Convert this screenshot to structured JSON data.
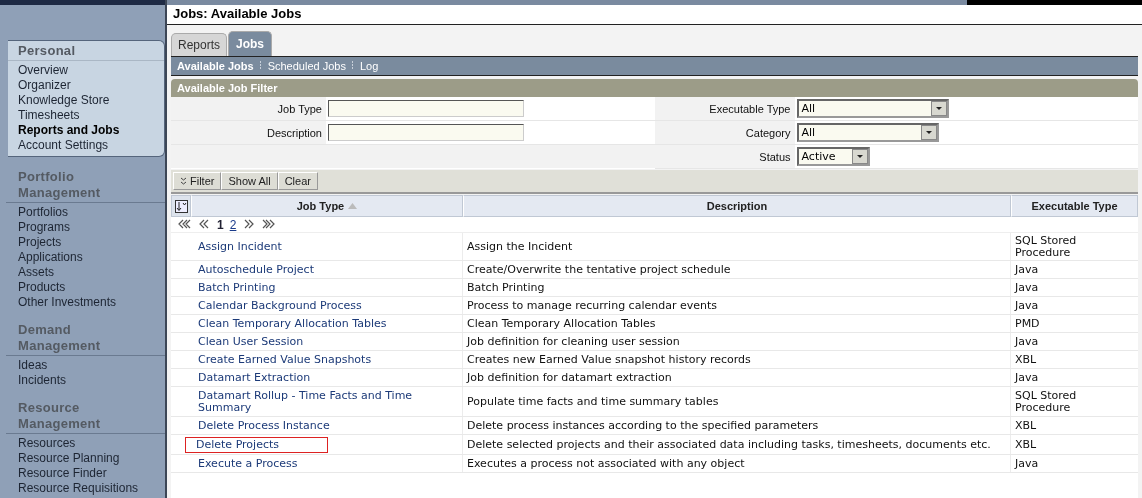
{
  "sidebar": {
    "sections": [
      {
        "title": "Personal",
        "selected": true,
        "items": [
          {
            "label": "Overview",
            "selected": false
          },
          {
            "label": "Organizer",
            "selected": false
          },
          {
            "label": "Knowledge Store",
            "selected": false
          },
          {
            "label": "Timesheets",
            "selected": false
          },
          {
            "label": "Reports and Jobs",
            "selected": true
          },
          {
            "label": "Account Settings",
            "selected": false
          }
        ]
      },
      {
        "title": "Portfolio Management",
        "selected": false,
        "items": [
          {
            "label": "Portfolios",
            "selected": false
          },
          {
            "label": "Programs",
            "selected": false
          },
          {
            "label": "Projects",
            "selected": false
          },
          {
            "label": "Applications",
            "selected": false
          },
          {
            "label": "Assets",
            "selected": false
          },
          {
            "label": "Products",
            "selected": false
          },
          {
            "label": "Other Investments",
            "selected": false
          }
        ]
      },
      {
        "title": "Demand Management",
        "selected": false,
        "items": [
          {
            "label": "Ideas",
            "selected": false
          },
          {
            "label": "Incidents",
            "selected": false
          }
        ]
      },
      {
        "title": "Resource Management",
        "selected": false,
        "items": [
          {
            "label": "Resources",
            "selected": false
          },
          {
            "label": "Resource Planning",
            "selected": false
          },
          {
            "label": "Resource Finder",
            "selected": false
          },
          {
            "label": "Resource Requisitions",
            "selected": false
          }
        ]
      }
    ]
  },
  "page_title": "Jobs: Available Jobs",
  "tabs": [
    {
      "label": "Reports",
      "selected": false
    },
    {
      "label": "Jobs",
      "selected": true
    }
  ],
  "subnav": [
    {
      "label": "Available Jobs",
      "selected": true
    },
    {
      "label": "Scheduled Jobs",
      "selected": false
    },
    {
      "label": "Log",
      "selected": false
    }
  ],
  "filter": {
    "title": "Available Job Filter",
    "left": [
      {
        "label": "Job Type",
        "kind": "text"
      },
      {
        "label": "Description",
        "kind": "text"
      }
    ],
    "right": [
      {
        "label": "Executable Type",
        "kind": "select",
        "value": "All"
      },
      {
        "label": "Category",
        "kind": "select",
        "value": "All"
      },
      {
        "label": "Status",
        "kind": "select",
        "value": "Active"
      }
    ]
  },
  "buttons": [
    {
      "label": "Filter",
      "kind": "toggle"
    },
    {
      "label": "Show All",
      "kind": "plain"
    },
    {
      "label": "Clear",
      "kind": "plain"
    }
  ],
  "table": {
    "columns": [
      {
        "label": "Job Type",
        "sorted": true
      },
      {
        "label": "Description",
        "sorted": false
      },
      {
        "label": "Executable Type",
        "sorted": false
      }
    ],
    "pages": [
      {
        "label": "1",
        "selected": true
      },
      {
        "label": "2",
        "selected": false
      }
    ],
    "rows": [
      {
        "job_type": "Assign Incident",
        "description": "Assign the Incident",
        "executable_type": "SQL Stored Procedure",
        "highlighted": false
      },
      {
        "job_type": "Autoschedule Project",
        "description": "Create/Overwrite the tentative project schedule",
        "executable_type": "Java",
        "highlighted": false
      },
      {
        "job_type": "Batch Printing",
        "description": "Batch Printing",
        "executable_type": "Java",
        "highlighted": false
      },
      {
        "job_type": "Calendar Background Process",
        "description": "Process to manage recurring calendar events",
        "executable_type": "Java",
        "highlighted": false
      },
      {
        "job_type": "Clean Temporary Allocation Tables",
        "description": "Clean Temporary Allocation Tables",
        "executable_type": "PMD",
        "highlighted": false
      },
      {
        "job_type": "Clean User Session",
        "description": "Job definition for cleaning user session",
        "executable_type": "Java",
        "highlighted": false
      },
      {
        "job_type": "Create Earned Value Snapshots",
        "description": "Creates new Earned Value snapshot history records",
        "executable_type": "XBL",
        "highlighted": false
      },
      {
        "job_type": "Datamart Extraction",
        "description": "Job definition for datamart extraction",
        "executable_type": "Java",
        "highlighted": false
      },
      {
        "job_type": "Datamart Rollup - Time Facts and Time Summary",
        "description": "Populate time facts and time summary tables",
        "executable_type": "SQL Stored Procedure",
        "highlighted": false
      },
      {
        "job_type": "Delete Process Instance",
        "description": "Delete process instances according to the specified parameters",
        "executable_type": "XBL",
        "highlighted": false
      },
      {
        "job_type": "Delete Projects",
        "description": "Delete selected projects and their associated data including tasks, timesheets, documents etc.",
        "executable_type": "XBL",
        "highlighted": true
      },
      {
        "job_type": "Execute a Process",
        "description": "Executes a process not associated with any object",
        "executable_type": "Java",
        "highlighted": false
      }
    ]
  }
}
